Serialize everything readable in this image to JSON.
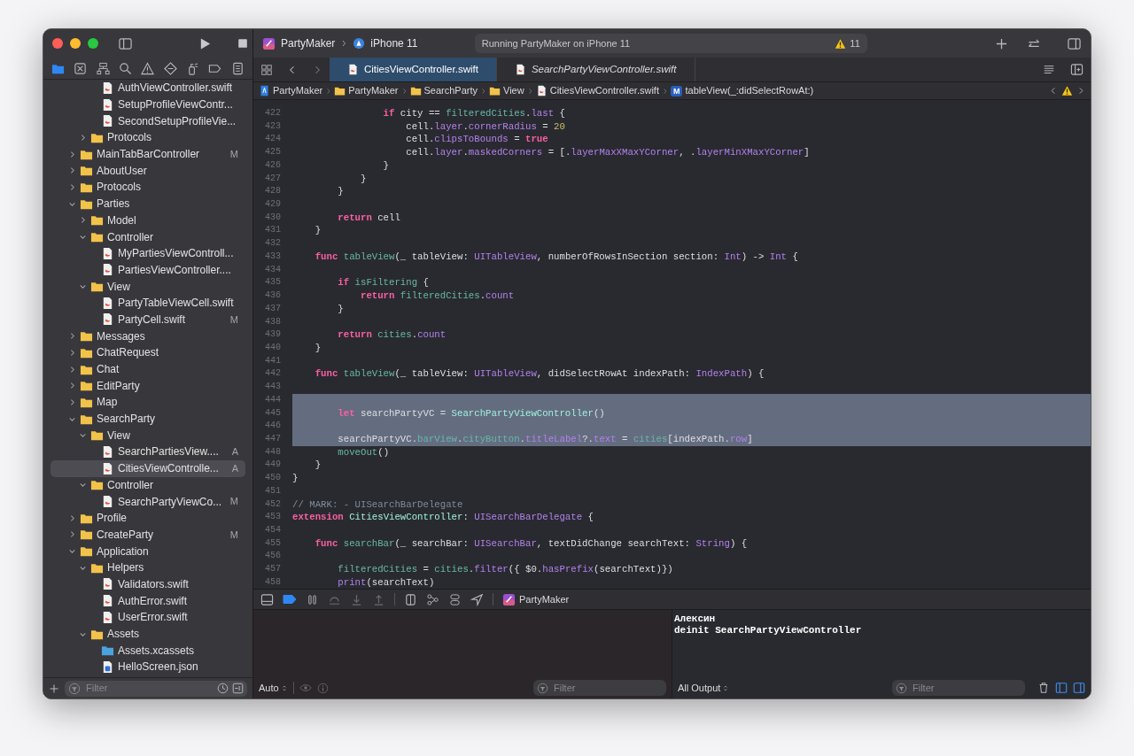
{
  "toolbar": {
    "scheme": "PartyMaker",
    "device": "iPhone 11",
    "activity": "Running PartyMaker on iPhone 11",
    "warning_count": "11"
  },
  "navigator_tabs": [
    {
      "kind": "project",
      "selected": true
    },
    {
      "kind": "source-control",
      "selected": false
    },
    {
      "kind": "symbols",
      "selected": false
    },
    {
      "kind": "find",
      "selected": false
    },
    {
      "kind": "issues",
      "selected": false
    },
    {
      "kind": "tests",
      "selected": false
    },
    {
      "kind": "debug",
      "selected": false
    },
    {
      "kind": "breakpoints",
      "selected": false
    },
    {
      "kind": "reports",
      "selected": false
    }
  ],
  "tree": [
    {
      "children": [
        {
          "children": [
            {
              "name": "AuthViewController.swift",
              "kind": "swift",
              "selected": false
            },
            {
              "name": "SetupProfileViewContr...",
              "kind": "swift",
              "selected": false
            },
            {
              "name": "SecondSetupProfileVie...",
              "kind": "swift",
              "selected": false
            }
          ]
        },
        {
          "name": "Protocols",
          "kind": "folder",
          "expanded": false,
          "selected": false
        }
      ]
    },
    {
      "name": "MainTabBarController",
      "kind": "folder",
      "expanded": false,
      "status": "M",
      "selected": false
    },
    {
      "name": "AboutUser",
      "kind": "folder",
      "expanded": false,
      "selected": false
    },
    {
      "name": "Protocols",
      "kind": "folder",
      "expanded": false,
      "selected": false
    },
    {
      "name": "Parties",
      "kind": "folder",
      "expanded": true,
      "selected": false,
      "children": [
        {
          "name": "Model",
          "kind": "folder",
          "expanded": false,
          "selected": false
        },
        {
          "name": "Controller",
          "kind": "folder",
          "expanded": true,
          "selected": false,
          "children": [
            {
              "name": "MyPartiesViewControll...",
              "kind": "swift",
              "selected": false
            },
            {
              "name": "PartiesViewController....",
              "kind": "swift",
              "selected": false
            }
          ]
        },
        {
          "name": "View",
          "kind": "folder",
          "expanded": true,
          "selected": false,
          "children": [
            {
              "name": "PartyTableViewCell.swift",
              "kind": "swift",
              "selected": false
            },
            {
              "name": "PartyCell.swift",
              "kind": "swift",
              "status": "M",
              "selected": false
            }
          ]
        }
      ]
    },
    {
      "name": "Messages",
      "kind": "folder",
      "expanded": false,
      "selected": false
    },
    {
      "name": "ChatRequest",
      "kind": "folder",
      "expanded": false,
      "selected": false
    },
    {
      "name": "Chat",
      "kind": "folder",
      "expanded": false,
      "selected": false
    },
    {
      "name": "EditParty",
      "kind": "folder",
      "expanded": false,
      "selected": false
    },
    {
      "name": "Map",
      "kind": "folder",
      "expanded": false,
      "selected": false
    },
    {
      "name": "SearchParty",
      "kind": "folder",
      "expanded": true,
      "selected": false,
      "children": [
        {
          "name": "View",
          "kind": "folder",
          "expanded": true,
          "selected": false,
          "children": [
            {
              "name": "SearchPartiesView....",
              "kind": "swift",
              "status": "A",
              "selected": false
            },
            {
              "name": "CitiesViewControlle...",
              "kind": "swift",
              "status": "A",
              "selected": true
            }
          ]
        },
        {
          "name": "Controller",
          "kind": "folder",
          "expanded": true,
          "selected": false,
          "children": [
            {
              "name": "SearchPartyViewCo...",
              "kind": "swift",
              "status": "M",
              "selected": false
            }
          ]
        }
      ]
    },
    {
      "name": "Profile",
      "kind": "folder",
      "expanded": false,
      "selected": false
    },
    {
      "name": "CreateParty",
      "kind": "folder",
      "expanded": false,
      "status": "M",
      "selected": false
    },
    {
      "name": "Application",
      "kind": "folder",
      "expanded": true,
      "selected": false,
      "children": [
        {
          "name": "Helpers",
          "kind": "folder",
          "expanded": true,
          "selected": false,
          "children": [
            {
              "name": "Validators.swift",
              "kind": "swift",
              "selected": false
            },
            {
              "name": "AuthError.swift",
              "kind": "swift",
              "selected": false
            },
            {
              "name": "UserError.swift",
              "kind": "swift",
              "selected": false
            }
          ]
        },
        {
          "name": "Assets",
          "kind": "folder",
          "expanded": true,
          "selected": false,
          "children": [
            {
              "name": "Assets.xcassets",
              "kind": "assets",
              "selected": false
            },
            {
              "name": "HelloScreen.json",
              "kind": "json",
              "selected": false
            }
          ]
        }
      ]
    }
  ],
  "navigator_filter": {
    "placeholder": "Filter"
  },
  "editor_tabs": [
    {
      "label": "CitiesViewController.swift",
      "selected": true,
      "preview": false
    },
    {
      "label": "SearchPartyViewController.swift",
      "selected": false,
      "preview": true
    }
  ],
  "breadcrumb": [
    {
      "label": "PartyMaker",
      "kind": "project"
    },
    {
      "label": "PartyMaker",
      "kind": "folder"
    },
    {
      "label": "SearchParty",
      "kind": "folder"
    },
    {
      "label": "View",
      "kind": "folder"
    },
    {
      "label": "CitiesViewController.swift",
      "kind": "swift"
    },
    {
      "label": "tableView(_:didSelectRowAt:)",
      "kind": "method",
      "badge": "M"
    }
  ],
  "code": [
    {
      "number": "422",
      "selected": false,
      "tokens": [
        {
          "kind": "kw",
          "text": "                if"
        },
        {
          "kind": "p",
          "text": " city == "
        },
        {
          "kind": "var",
          "text": "filteredCities"
        },
        {
          "kind": "p",
          "text": "."
        },
        {
          "kind": "sys",
          "text": "last"
        },
        {
          "kind": "p",
          "text": " {"
        }
      ]
    },
    {
      "number": "423",
      "selected": false,
      "tokens": [
        {
          "kind": "p",
          "text": "                    cell."
        },
        {
          "kind": "sys",
          "text": "layer"
        },
        {
          "kind": "p",
          "text": "."
        },
        {
          "kind": "sys",
          "text": "cornerRadius"
        },
        {
          "kind": "p",
          "text": " = "
        },
        {
          "kind": "num",
          "text": "20"
        }
      ]
    },
    {
      "number": "424",
      "selected": false,
      "tokens": [
        {
          "kind": "p",
          "text": "                    cell."
        },
        {
          "kind": "sys",
          "text": "clipsToBounds"
        },
        {
          "kind": "p",
          "text": " = "
        },
        {
          "kind": "kw",
          "text": "true"
        }
      ]
    },
    {
      "number": "425",
      "selected": false,
      "tokens": [
        {
          "kind": "p",
          "text": "                    cell."
        },
        {
          "kind": "sys",
          "text": "layer"
        },
        {
          "kind": "p",
          "text": "."
        },
        {
          "kind": "sys",
          "text": "maskedCorners"
        },
        {
          "kind": "p",
          "text": " = [."
        },
        {
          "kind": "sys",
          "text": "layerMaxXMaxYCorner"
        },
        {
          "kind": "p",
          "text": ", ."
        },
        {
          "kind": "sys",
          "text": "layerMinXMaxYCorner"
        },
        {
          "kind": "p",
          "text": "]"
        }
      ]
    },
    {
      "number": "426",
      "selected": false,
      "tokens": [
        {
          "kind": "p",
          "text": "                }"
        }
      ]
    },
    {
      "number": "427",
      "selected": false,
      "tokens": [
        {
          "kind": "p",
          "text": "            }"
        }
      ]
    },
    {
      "number": "428",
      "selected": false,
      "tokens": [
        {
          "kind": "p",
          "text": "        }"
        }
      ]
    },
    {
      "number": "429",
      "selected": false
    },
    {
      "number": "430",
      "selected": false,
      "tokens": [
        {
          "kind": "kw",
          "text": "        return"
        },
        {
          "kind": "p",
          "text": " cell"
        }
      ]
    },
    {
      "number": "431",
      "selected": false,
      "tokens": [
        {
          "kind": "p",
          "text": "    }"
        }
      ]
    },
    {
      "number": "432",
      "selected": false
    },
    {
      "number": "433",
      "selected": false,
      "tokens": [
        {
          "kind": "kw",
          "text": "    func"
        },
        {
          "kind": "fn",
          "text": " tableView"
        },
        {
          "kind": "p",
          "text": "(_ tableView: "
        },
        {
          "kind": "sys",
          "text": "UITableView"
        },
        {
          "kind": "p",
          "text": ", numberOfRowsInSection section: "
        },
        {
          "kind": "sys",
          "text": "Int"
        },
        {
          "kind": "p",
          "text": ") -> "
        },
        {
          "kind": "sys",
          "text": "Int"
        },
        {
          "kind": "p",
          "text": " {"
        }
      ]
    },
    {
      "number": "434",
      "selected": false
    },
    {
      "number": "435",
      "selected": false,
      "tokens": [
        {
          "kind": "kw",
          "text": "        if"
        },
        {
          "kind": "var",
          "text": " isFiltering"
        },
        {
          "kind": "p",
          "text": " {"
        }
      ]
    },
    {
      "number": "436",
      "selected": false,
      "tokens": [
        {
          "kind": "kw",
          "text": "            return"
        },
        {
          "kind": "var",
          "text": " filteredCities"
        },
        {
          "kind": "p",
          "text": "."
        },
        {
          "kind": "sys",
          "text": "count"
        }
      ]
    },
    {
      "number": "437",
      "selected": false,
      "tokens": [
        {
          "kind": "p",
          "text": "        }"
        }
      ]
    },
    {
      "number": "438",
      "selected": false
    },
    {
      "number": "439",
      "selected": false,
      "tokens": [
        {
          "kind": "kw",
          "text": "        return"
        },
        {
          "kind": "var",
          "text": " cities"
        },
        {
          "kind": "p",
          "text": "."
        },
        {
          "kind": "sys",
          "text": "count"
        }
      ]
    },
    {
      "number": "440",
      "selected": false,
      "tokens": [
        {
          "kind": "p",
          "text": "    }"
        }
      ]
    },
    {
      "number": "441",
      "selected": false
    },
    {
      "number": "442",
      "selected": false,
      "tokens": [
        {
          "kind": "kw",
          "text": "    func"
        },
        {
          "kind": "fn",
          "text": " tableView"
        },
        {
          "kind": "p",
          "text": "(_ tableView: "
        },
        {
          "kind": "sys",
          "text": "UITableView"
        },
        {
          "kind": "p",
          "text": ", didSelectRowAt indexPath: "
        },
        {
          "kind": "sys",
          "text": "IndexPath"
        },
        {
          "kind": "p",
          "text": ") {"
        }
      ]
    },
    {
      "number": "443",
      "selected": false
    },
    {
      "number": "444",
      "selected": true
    },
    {
      "number": "445",
      "selected": true,
      "tokens": [
        {
          "kind": "kw",
          "text": "        let"
        },
        {
          "kind": "p",
          "text": " searchPartyVC = "
        },
        {
          "kind": "type",
          "text": "SearchPartyViewController"
        },
        {
          "kind": "p",
          "text": "()"
        }
      ]
    },
    {
      "number": "446",
      "selected": true
    },
    {
      "number": "447",
      "selected": true,
      "tokens": [
        {
          "kind": "p",
          "text": "        searchPartyVC."
        },
        {
          "kind": "var",
          "text": "barView"
        },
        {
          "kind": "p",
          "text": "."
        },
        {
          "kind": "var",
          "text": "cityButton"
        },
        {
          "kind": "p",
          "text": "."
        },
        {
          "kind": "sys",
          "text": "titleLabel"
        },
        {
          "kind": "p",
          "text": "?."
        },
        {
          "kind": "sys",
          "text": "text"
        },
        {
          "kind": "p",
          "text": " = "
        },
        {
          "kind": "var",
          "text": "cities"
        },
        {
          "kind": "p",
          "text": "[indexPath."
        },
        {
          "kind": "sys",
          "text": "row"
        },
        {
          "kind": "p",
          "text": "]"
        }
      ]
    },
    {
      "number": "448",
      "selected": false,
      "tokens": [
        {
          "kind": "var",
          "text": "        moveOut"
        },
        {
          "kind": "p",
          "text": "()"
        }
      ]
    },
    {
      "number": "449",
      "selected": false,
      "tokens": [
        {
          "kind": "p",
          "text": "    }"
        }
      ]
    },
    {
      "number": "450",
      "selected": false,
      "tokens": [
        {
          "kind": "p",
          "text": "}"
        }
      ]
    },
    {
      "number": "451",
      "selected": false
    },
    {
      "number": "452",
      "selected": false,
      "tokens": [
        {
          "kind": "cm",
          "text": "// MARK: - UISearchBarDelegate"
        }
      ]
    },
    {
      "number": "453",
      "selected": false,
      "tokens": [
        {
          "kind": "kw",
          "text": "extension"
        },
        {
          "kind": "type",
          "text": " CitiesViewController"
        },
        {
          "kind": "p",
          "text": ": "
        },
        {
          "kind": "sys",
          "text": "UISearchBarDelegate"
        },
        {
          "kind": "p",
          "text": " {"
        }
      ]
    },
    {
      "number": "454",
      "selected": false
    },
    {
      "number": "455",
      "selected": false,
      "tokens": [
        {
          "kind": "kw",
          "text": "    func"
        },
        {
          "kind": "fn",
          "text": " searchBar"
        },
        {
          "kind": "p",
          "text": "(_ searchBar: "
        },
        {
          "kind": "sys",
          "text": "UISearchBar"
        },
        {
          "kind": "p",
          "text": ", textDidChange searchText: "
        },
        {
          "kind": "sys",
          "text": "String"
        },
        {
          "kind": "p",
          "text": ") {"
        }
      ]
    },
    {
      "number": "456",
      "selected": false
    },
    {
      "number": "457",
      "selected": false,
      "tokens": [
        {
          "kind": "var",
          "text": "        filteredCities"
        },
        {
          "kind": "p",
          "text": " = "
        },
        {
          "kind": "var",
          "text": "cities"
        },
        {
          "kind": "p",
          "text": "."
        },
        {
          "kind": "sys",
          "text": "filter"
        },
        {
          "kind": "p",
          "text": "({ $0."
        },
        {
          "kind": "sys",
          "text": "hasPrefix"
        },
        {
          "kind": "p",
          "text": "(searchText)})"
        }
      ]
    },
    {
      "number": "458",
      "selected": false,
      "tokens": [
        {
          "kind": "sys",
          "text": "        print"
        },
        {
          "kind": "p",
          "text": "(searchText)"
        }
      ]
    }
  ],
  "debug_bar": {
    "breakpoints_active": true,
    "target": "PartyMaker"
  },
  "variables": {
    "scope": "Auto",
    "placeholder": "Filter"
  },
  "console": {
    "output": [
      "Алексин",
      "deinit SearchPartyViewController"
    ],
    "scope": "All Output",
    "placeholder": "Filter",
    "show_variables": true,
    "show_console": true
  }
}
